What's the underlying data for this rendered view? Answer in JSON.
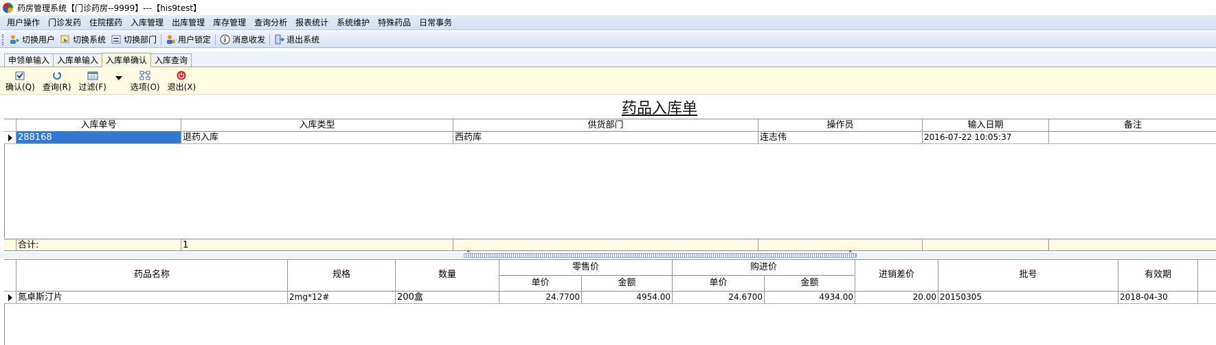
{
  "window": {
    "title": "药房管理系统【门诊药房--9999】---【his9test】"
  },
  "menu": [
    {
      "label": "用户操作"
    },
    {
      "label": "门诊发药"
    },
    {
      "label": "住院摆药"
    },
    {
      "label": "入库管理"
    },
    {
      "label": "出库管理"
    },
    {
      "label": "库存管理"
    },
    {
      "label": "查询分析"
    },
    {
      "label": "报表统计"
    },
    {
      "label": "系统维护"
    },
    {
      "label": "特殊药品"
    },
    {
      "label": "日常事务"
    }
  ],
  "toolbar": [
    {
      "label": "切换用户",
      "icon": "switch-user-icon"
    },
    {
      "label": "切换系统",
      "icon": "switch-system-icon"
    },
    {
      "label": "切换部门",
      "icon": "switch-department-icon"
    },
    {
      "label": "用户锁定",
      "icon": "user-lock-icon"
    },
    {
      "label": "消息收发",
      "icon": "info-icon"
    },
    {
      "label": "退出系统",
      "icon": "exit-icon"
    }
  ],
  "tabs": [
    {
      "label": "申领单输入"
    },
    {
      "label": "入库单输入"
    },
    {
      "label": "入库单确认",
      "active": true
    },
    {
      "label": "入库查询"
    }
  ],
  "actions": {
    "confirm": "确认(Q)",
    "query": "查询(R)",
    "filter": "过滤(F)",
    "options": "选项(O)",
    "exit": "退出(X)"
  },
  "form_title": "药品入库单",
  "master_grid": {
    "headers": [
      "入库单号",
      "入库类型",
      "供货部门",
      "操作员",
      "输入日期",
      "备注"
    ],
    "rows": [
      [
        "288168",
        "退药入库",
        "西药库",
        "连志伟",
        "2016-07-22 10:05:37",
        ""
      ]
    ],
    "summary": {
      "label": "合计:",
      "count": "1"
    }
  },
  "detail_grid": {
    "headers": {
      "name": "药品名称",
      "spec": "规格",
      "qty": "数量",
      "retail_group": "零售价",
      "retail_unit": "单价",
      "retail_amount": "金额",
      "purchase_group": "购进价",
      "purchase_unit": "单价",
      "purchase_amount": "金额",
      "diff": "进销差价",
      "batch": "批号",
      "expiry": "有效期"
    },
    "rows": [
      {
        "name": "氮卓斯汀片",
        "spec": "2mg*12#",
        "qty": "200盒",
        "retail_unit": "24.7700",
        "retail_amount": "4954.00",
        "purchase_unit": "24.6700",
        "purchase_amount": "4934.00",
        "diff": "20.00",
        "batch": "20150305",
        "expiry": "2018-04-30"
      }
    ]
  },
  "colors": {
    "selection": "#3379d0",
    "panel": "#fffbe3",
    "menubar": "#d4e1f3"
  }
}
